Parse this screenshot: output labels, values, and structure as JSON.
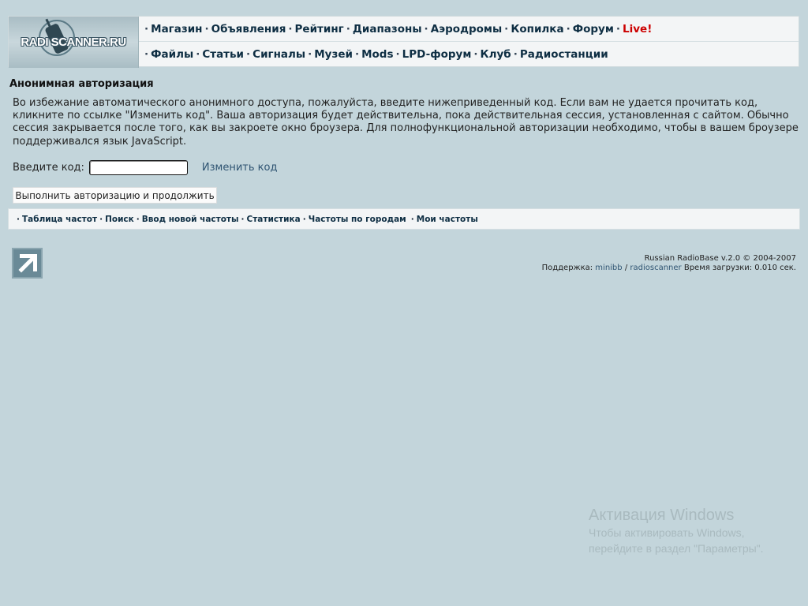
{
  "logo": {
    "text": "RADI SCANNER.RU"
  },
  "nav": {
    "row1": [
      {
        "label": "Магазин"
      },
      {
        "label": "Объявления"
      },
      {
        "label": "Рейтинг"
      },
      {
        "label": "Диапазоны"
      },
      {
        "label": "Аэродромы"
      },
      {
        "label": "Копилка"
      },
      {
        "label": "Форум"
      },
      {
        "label": "Live!"
      }
    ],
    "row2": [
      {
        "label": "Файлы"
      },
      {
        "label": "Статьи"
      },
      {
        "label": "Сигналы"
      },
      {
        "label": "Музей"
      },
      {
        "label": "Mods"
      },
      {
        "label": "LPD-форум"
      },
      {
        "label": "Клуб"
      },
      {
        "label": "Радиостанции"
      }
    ],
    "separator": "·"
  },
  "auth": {
    "title": "Анонимная авторизация",
    "description": "Во избежание автоматического анонимного доступа, пожалуйста, введите нижеприведенный код. Если вам не удается прочитать код, кликните по ссылке \"Изменить код\". Ваша авторизация будет действительна, пока действительная сессия, установленная с сайтом. Обычно сессия закрывается после того, как вы закроете окно броузера. Для полнофункциональной авторизации необходимо, чтобы в вашем броузере поддерживался язык JavaScript.",
    "code_label": "Введите код:",
    "code_value": "",
    "change_code": "Изменить код",
    "submit": "Выполнить авторизацию и продолжить"
  },
  "subnav": [
    {
      "label": "Таблица частот"
    },
    {
      "label": "Поиск"
    },
    {
      "label": "Ввод новой частоты"
    },
    {
      "label": "Статистика"
    },
    {
      "label": "Частоты по городам"
    },
    {
      "label": "Мои частоты"
    }
  ],
  "footer": {
    "copyright": "Russian RadioBase v.2.0 © 2004-2007",
    "support_label": "Поддержка:",
    "minibb": "minibb",
    "slash": "/",
    "radioscanner": "radioscanner",
    "load_time": "Время загрузки: 0.010 сек."
  },
  "watermark": {
    "title": "Активация Windows",
    "line1": "Чтобы активировать Windows,",
    "line2": "перейдите в раздел \"Параметры\"."
  },
  "colors": {
    "background": "#c3d5db",
    "live": "#cc0000",
    "link": "#2f5472"
  }
}
